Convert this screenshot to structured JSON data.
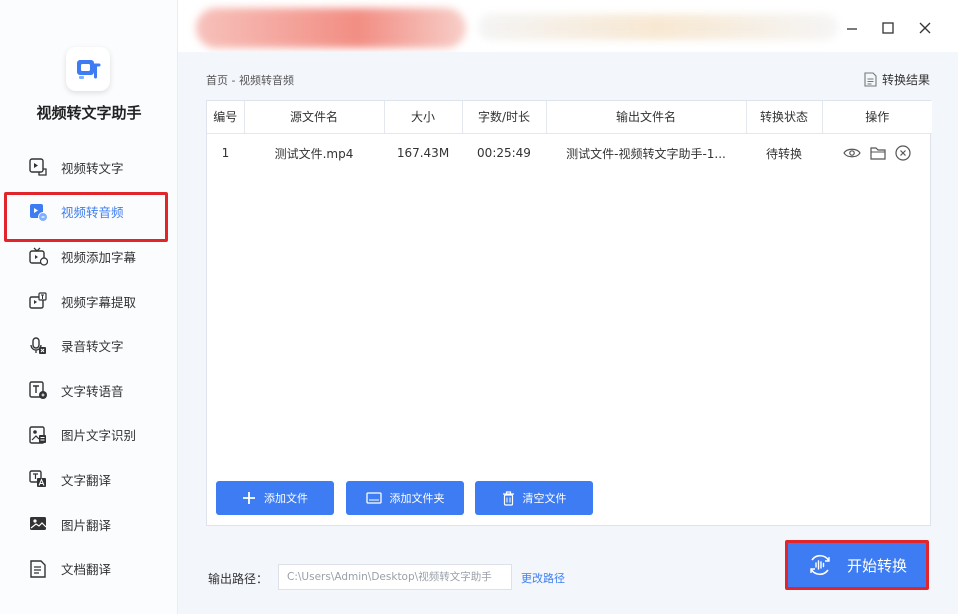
{
  "app": {
    "name": "视频转文字助手"
  },
  "sidebar": {
    "items": [
      {
        "label": "视频转文字",
        "icon": "video-text-icon"
      },
      {
        "label": "视频转音频",
        "icon": "video-audio-icon",
        "active": true
      },
      {
        "label": "视频添加字幕",
        "icon": "tv-subtitle-icon"
      },
      {
        "label": "视频字幕提取",
        "icon": "subtitle-extract-icon"
      },
      {
        "label": "录音转文字",
        "icon": "mic-text-icon"
      },
      {
        "label": "文字转语音",
        "icon": "text-speech-icon"
      },
      {
        "label": "图片文字识别",
        "icon": "image-ocr-icon"
      },
      {
        "label": "文字翻译",
        "icon": "text-translate-icon"
      },
      {
        "label": "图片翻译",
        "icon": "image-translate-icon"
      },
      {
        "label": "文档翻译",
        "icon": "doc-translate-icon"
      }
    ]
  },
  "breadcrumb": "首页 - 视频转音频",
  "result_link": "转换结果",
  "table": {
    "headers": [
      "编号",
      "源文件名",
      "大小",
      "字数/时长",
      "输出文件名",
      "转换状态",
      "操作"
    ],
    "rows": [
      {
        "index": "1",
        "source": "测试文件.mp4",
        "size": "167.43M",
        "duration": "00:25:49",
        "output": "测试文件-视频转文字助手-1...",
        "status": "待转换"
      }
    ]
  },
  "buttons": {
    "add_file": "添加文件",
    "add_folder": "添加文件夹",
    "clear_files": "清空文件",
    "start": "开始转换",
    "change_path": "更改路径"
  },
  "output": {
    "label": "输出路径：",
    "path": "C:\\Users\\Admin\\Desktop\\视频转文字助手"
  },
  "colors": {
    "accent": "#3d7cf2",
    "highlight": "#e0262b"
  }
}
